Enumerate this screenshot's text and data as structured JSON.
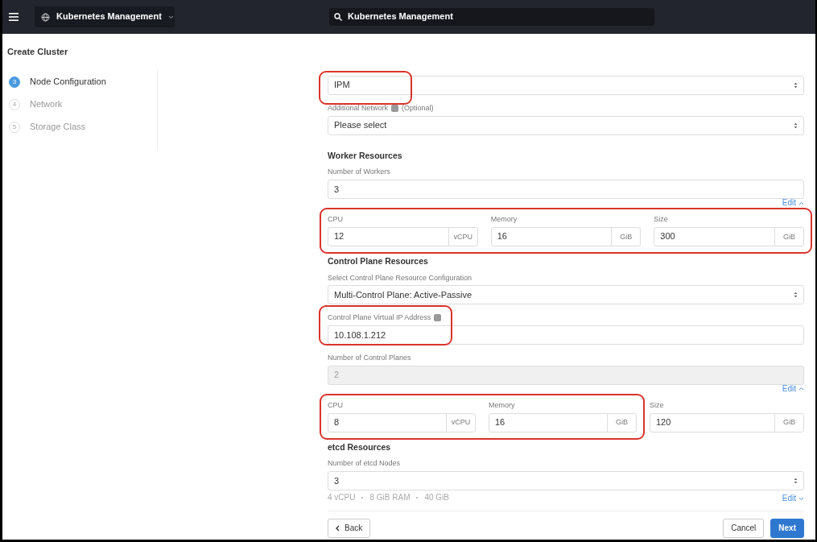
{
  "topbar": {
    "app_switcher": "Kubernetes Management",
    "search": "Kubernetes Management"
  },
  "page_title": "Create Cluster",
  "steps": [
    {
      "number": "3",
      "label": "Node Configuration",
      "selected": true
    },
    {
      "number": "4",
      "label": "Network",
      "selected": false
    },
    {
      "number": "5",
      "label": "Storage Class",
      "selected": false
    }
  ],
  "form": [
    {
      "kind": "select",
      "value": "IPM",
      "highlighted": true
    },
    {
      "kind": "select",
      "label": "Additional Network",
      "help": true,
      "label_suffix": "(Optional)",
      "value": "Please select"
    },
    {
      "kind": "heading",
      "text": "Worker Resources"
    },
    {
      "kind": "input",
      "label": "Number of Workers",
      "value": "3"
    },
    {
      "kind": "edit_link",
      "text": "Edit",
      "expanded": true
    },
    {
      "kind": "resources",
      "fields": [
        {
          "label": "CPU",
          "value": "12",
          "unit": "vCPU",
          "highlighted": true
        },
        {
          "label": "Memory",
          "value": "16",
          "unit": "GiB",
          "highlighted": true
        },
        {
          "label": "Size",
          "value": "300",
          "unit": "GiB",
          "highlighted": true
        }
      ]
    },
    {
      "kind": "heading",
      "text": "Control Plane Resources"
    },
    {
      "kind": "select",
      "label": "Select Control Plane Resource Configuration",
      "value": "Multi-Control Plane: Active-Passive"
    },
    {
      "kind": "input",
      "label": "Control Plane Virtual IP Address",
      "help": true,
      "value": "10.108.1.212",
      "highlighted": true
    },
    {
      "kind": "input",
      "label": "Number of Control Planes",
      "value": "2",
      "disabled": true
    },
    {
      "kind": "edit_link",
      "text": "Edit",
      "expanded": true
    },
    {
      "kind": "resources",
      "fields": [
        {
          "label": "CPU",
          "value": "8",
          "unit": "vCPU",
          "highlighted": true
        },
        {
          "label": "Memory",
          "value": "16",
          "unit": "GiB",
          "highlighted": true
        },
        {
          "label": "Size",
          "value": "120",
          "unit": "GiB",
          "highlighted": false
        }
      ]
    },
    {
      "kind": "heading",
      "text": "etcd Resources"
    },
    {
      "kind": "select",
      "label": "Number of etcd Nodes",
      "value": "3"
    },
    {
      "kind": "summary",
      "items": [
        "4 vCPU",
        "8 GiB RAM",
        "40 GiB"
      ],
      "edit": {
        "text": "Edit",
        "expanded": false
      }
    }
  ],
  "footer": {
    "back": "Back",
    "cancel": "Cancel",
    "next": "Next"
  }
}
